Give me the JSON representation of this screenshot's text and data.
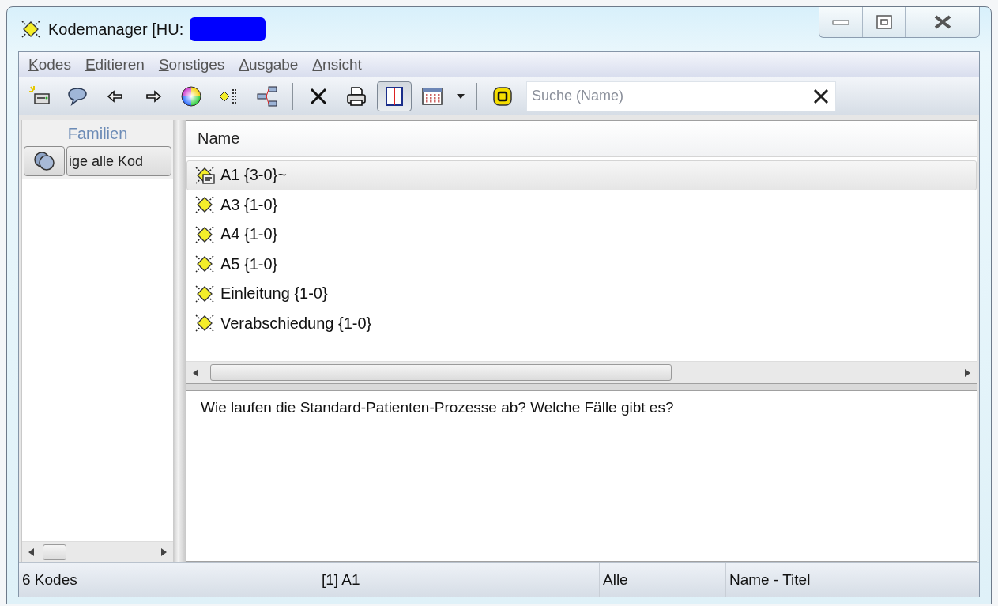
{
  "window": {
    "title": "Kodemanager [HU:",
    "title_redacted": true
  },
  "menu": [
    {
      "label": "Kodes"
    },
    {
      "label": "Editieren"
    },
    {
      "label": "Sonstiges"
    },
    {
      "label": "Ausgabe"
    },
    {
      "label": "Ansicht"
    }
  ],
  "toolbar": [
    {
      "kind": "new-code"
    },
    {
      "kind": "comment"
    },
    {
      "kind": "back"
    },
    {
      "kind": "forward"
    },
    {
      "kind": "color"
    },
    {
      "kind": "sort"
    },
    {
      "kind": "tree"
    },
    {
      "kind": "sep"
    },
    {
      "kind": "delete"
    },
    {
      "kind": "print"
    },
    {
      "kind": "split",
      "pressed": true
    },
    {
      "kind": "calendar"
    },
    {
      "kind": "dropdown"
    },
    {
      "kind": "sep"
    },
    {
      "kind": "filter"
    }
  ],
  "search": {
    "placeholder": "Suche (Name)"
  },
  "families": {
    "title": "Familien",
    "show_all_button": "ige alle Kod"
  },
  "table": {
    "columns": [
      "Name"
    ],
    "rows": [
      {
        "name": "A1 {3-0}~",
        "kind": "memo",
        "selected": true
      },
      {
        "name": "A3 {1-0}",
        "kind": "plain",
        "selected": false
      },
      {
        "name": "A4 {1-0}",
        "kind": "plain",
        "selected": false
      },
      {
        "name": "A5 {1-0}",
        "kind": "plain",
        "selected": false
      },
      {
        "name": "Einleitung {1-0}",
        "kind": "plain",
        "selected": false
      },
      {
        "name": "Verabschiedung {1-0}",
        "kind": "plain",
        "selected": false
      }
    ]
  },
  "comment": "Wie laufen die Standard-Patienten-Prozesse ab? Welche Fälle gibt es?",
  "status_bar": [
    "6 Kodes",
    "[1] A1",
    "Alle",
    "Name - Titel"
  ]
}
